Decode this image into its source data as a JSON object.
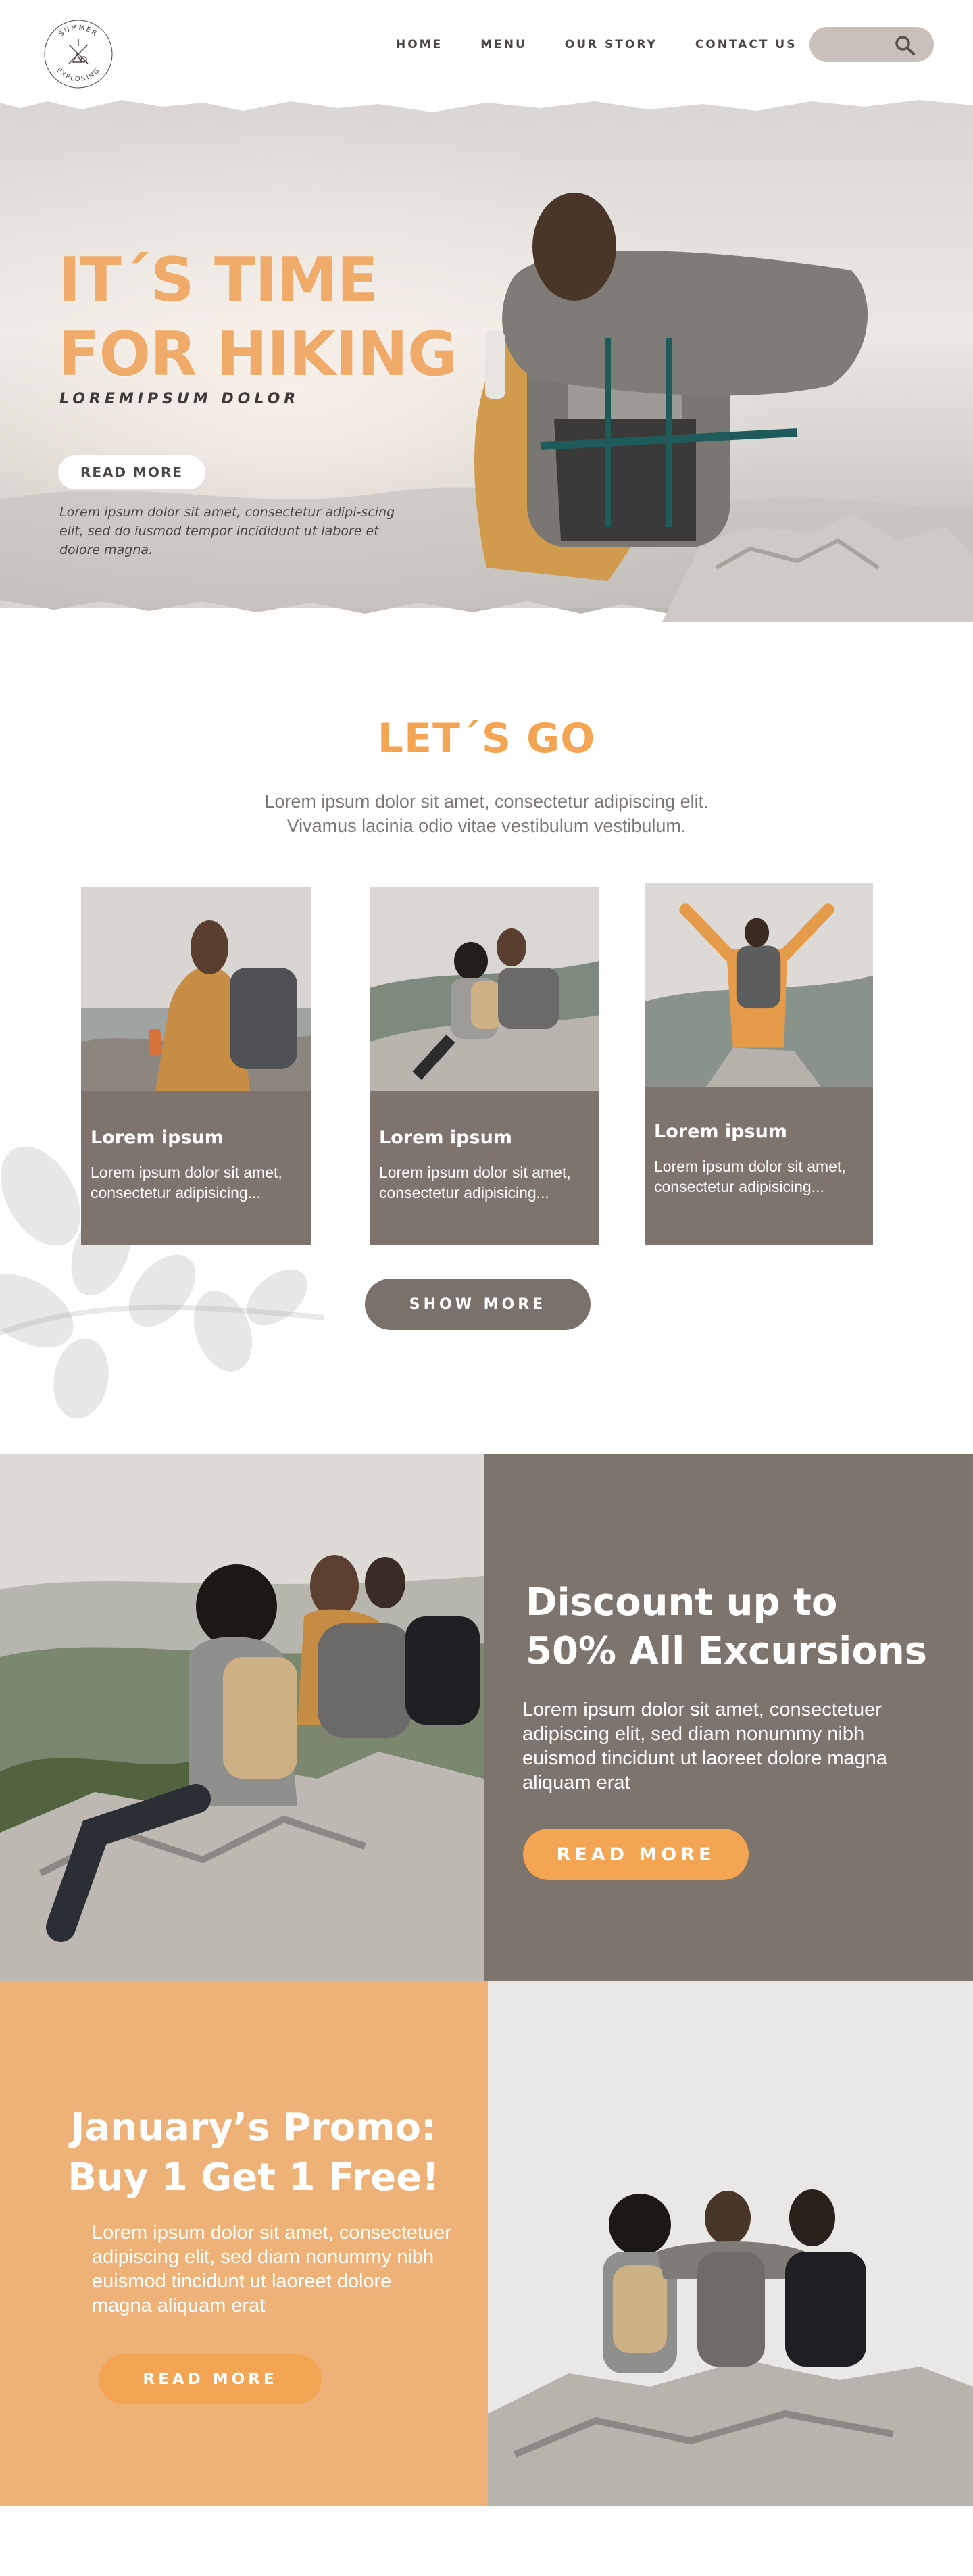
{
  "brand": {
    "logo_top": "SUMMER",
    "logo_bottom": "EXPLORING"
  },
  "nav": {
    "items": [
      "HOME",
      "MENU",
      "OUR STORY",
      "CONTACT US"
    ]
  },
  "search": {
    "icon": "search-icon"
  },
  "hero": {
    "title_line1": "IT´S TIME",
    "title_line2": "FOR HIKING",
    "subtitle": "LOREMIPSUM DOLOR",
    "button": "READ MORE",
    "text": "Lorem ipsum dolor sit amet, consectetur adipi-scing elit, sed do iusmod tempor incididunt ut labore et dolore magna."
  },
  "lets_go": {
    "title": "LET´S GO",
    "text_line1": "Lorem ipsum dolor sit amet, consectetur adipiscing elit.",
    "text_line2": "Vivamus lacinia odio vitae vestibulum vestibulum.",
    "cards": [
      {
        "title": "Lorem ipsum",
        "text": "Lorem ipsum dolor sit amet, consectetur  adipisicing..."
      },
      {
        "title": "Lorem ipsum",
        "text": "Lorem ipsum dolor sit amet, consectetur  adipisicing..."
      },
      {
        "title": "Lorem ipsum",
        "text": "Lorem ipsum dolor sit amet, consectetur  adipisicing..."
      }
    ],
    "show_more": "SHOW MORE"
  },
  "discount": {
    "title_line1": "Discount up to",
    "title_line2": "50% All Excursions",
    "text": "Lorem ipsum dolor sit amet, consectetuer adipiscing elit, sed diam nonummy nibh euismod tincidunt ut laoreet dolore magna aliquam erat",
    "button": "READ MORE"
  },
  "promo": {
    "title_line1": "January’s Promo:",
    "title_line2": "Buy 1 Get 1 Free!",
    "text": "Lorem ipsum dolor sit amet, consectetuer adipiscing elit, sed diam nonummy nibh euismod tincidunt ut laoreet dolore magna aliquam erat",
    "button": "READ MORE"
  },
  "colors": {
    "accent_orange": "#f3a553",
    "hero_title": "#f0ab6a",
    "taupe": "#7d746e",
    "promo_bg": "#eeb278",
    "search_bg": "#c8c0bb"
  }
}
